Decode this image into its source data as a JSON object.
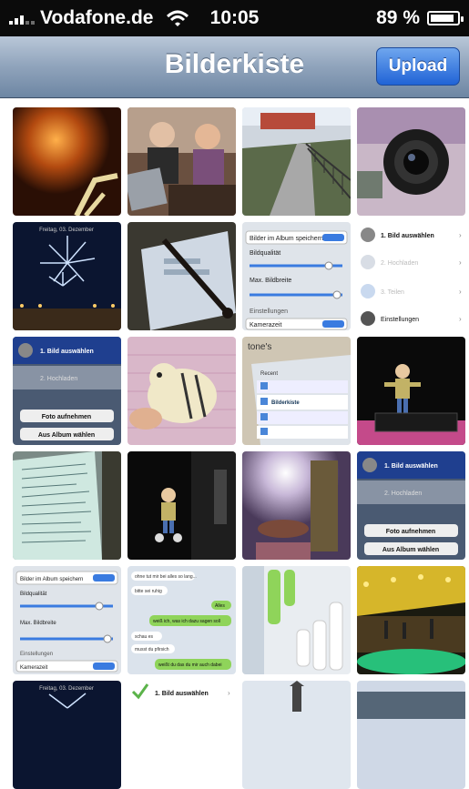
{
  "status_bar": {
    "carrier": "Vodafone.de",
    "time": "10:05",
    "battery_percent": "89 %",
    "battery_level": 0.89,
    "wifi_icon": "wifi-icon",
    "signal_icon": "signal-bars-icon"
  },
  "nav": {
    "title": "Bilderkiste",
    "upload_label": "Upload",
    "bar_color": "#8fa3bb",
    "button_color": "#2f72e0"
  },
  "grid": {
    "tiles": [
      {
        "desc": "night street with road markings"
      },
      {
        "desc": "people at a table with laptop"
      },
      {
        "desc": "sidewalk path along fence"
      },
      {
        "desc": "camera lens closeup"
      },
      {
        "desc": "fireworks over water"
      },
      {
        "desc": "phone screen photo"
      },
      {
        "desc": "app settings screenshot"
      },
      {
        "desc": "app menu screenshot"
      },
      {
        "desc": "app photo picker screenshot"
      },
      {
        "desc": "plush tiger toy"
      },
      {
        "desc": "app folder list screenshot"
      },
      {
        "desc": "toy figure on desk at night"
      },
      {
        "desc": "sheet of paper closeup"
      },
      {
        "desc": "toy figure in dark"
      },
      {
        "desc": "person lying on floor"
      },
      {
        "desc": "app photo picker screenshot"
      },
      {
        "desc": "app settings screenshot"
      },
      {
        "desc": "chat messages screenshot"
      },
      {
        "desc": "chat messages rotated screenshot"
      },
      {
        "desc": "event hall with lights"
      },
      {
        "desc": "fireworks partial"
      },
      {
        "desc": "app menu partial"
      },
      {
        "desc": "church tower partial"
      },
      {
        "desc": "building partial"
      }
    ],
    "screenshot_text": {
      "bild_auswaehlen": "1. Bild auswählen",
      "hochladen": "2. Hochladen",
      "teilen": "3. Teilen",
      "einstellungen": "Einstellungen",
      "foto_aufnehmen": "Foto aufnehmen",
      "aus_album": "Aus Album wählen",
      "bilder_album": "Bilder im Album speichern",
      "bildqualitaet": "Bildqualität",
      "max_bildbreite": "Max. Bildbreite",
      "kameraeinstellungen": "Einstellungen",
      "kameraeinst_sub": "Kamerazeit",
      "recent": "Recent",
      "bilderkiste": "Bilderkiste",
      "chat1": "ohne tut mir bei alles so lang...",
      "chat2": "bitte sei ruhig",
      "chat3": "Alles",
      "chat4": "weiß ich, was ich dazu sagen soll",
      "chat5": "schau es",
      "chat6": "musst du pfirsich",
      "chat7": "weißt du das du mir auch dabei"
    }
  }
}
